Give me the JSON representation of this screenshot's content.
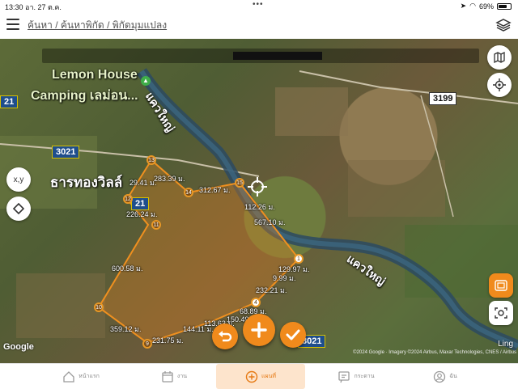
{
  "status": {
    "time": "13:30",
    "date": "อา. 27 ต.ค.",
    "battery": "69%",
    "battery_level": 0.69
  },
  "header": {
    "breadcrumb": "ค้นหา / ค้นหาพิกัด / พิกัดมุมแปลง"
  },
  "map": {
    "labels": {
      "poi_line1": "Lemon House",
      "poi_line2": "Camping เลม่อน...",
      "river_top": "แควใหญ่",
      "river_right": "แควใหญ่",
      "village": "ธารทองวิลล์",
      "road_3199": "3199",
      "road_3021a": "3021",
      "road_3021b": "3021",
      "road_21a": "21",
      "road_21b": "21",
      "google": "Google",
      "ling": "Ling",
      "attribution": "©2024 Google · Imagery ©2024 Airbus, Maxar Technologies, CNES / Airbus"
    },
    "vertices": [
      "13",
      "12",
      "11",
      "10",
      "9",
      "14",
      "15",
      "1",
      "4"
    ],
    "distances": {
      "d1": "283.39 ม.",
      "d2": "29.41 ม.",
      "d3": "312.67 ม.",
      "d4": "226.24 ม.",
      "d5": "112.26 ม.",
      "d6": "567.10 ม.",
      "d7": "600.58 ม.",
      "d8": "129.97 ม.",
      "d9": "9.99 ม.",
      "d10": "232.21 ม.",
      "d11": "68.89 ม.",
      "d12": "150.49 ม.",
      "d13": "359.12 ม.",
      "d14": "144.11 ม.",
      "d15": "113.63 ม.",
      "d16": "231.75 ม."
    },
    "side_buttons": {
      "xy": "x,y"
    }
  },
  "tabs": [
    {
      "label": "หน้าแรก",
      "icon": "home-icon"
    },
    {
      "label": "งาน",
      "icon": "calendar-icon"
    },
    {
      "label": "แผนที่",
      "icon": "map-plus-icon"
    },
    {
      "label": "กระดาน",
      "icon": "board-icon"
    },
    {
      "label": "ฉัน",
      "icon": "user-icon"
    }
  ],
  "colors": {
    "accent": "#f08a1c",
    "active_tab_bg": "#fde4cc"
  }
}
